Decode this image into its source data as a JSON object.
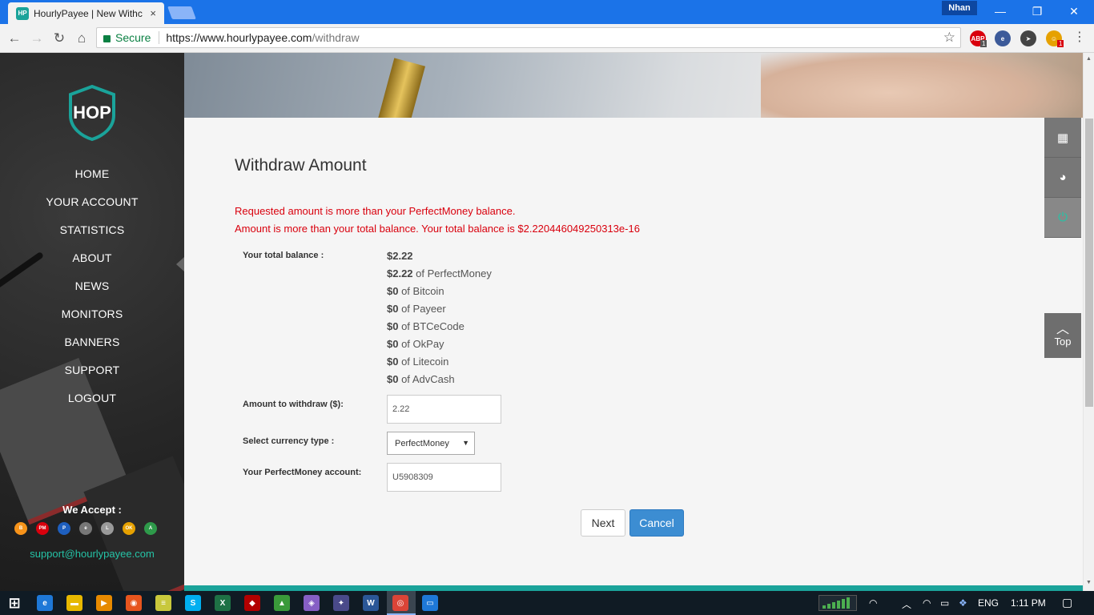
{
  "browser": {
    "tab_title": "HourlyPayee | New Withc",
    "tab_favicon_text": "HP",
    "close_glyph": "×",
    "profile_name": "Nhan",
    "window_controls": {
      "minimize": "—",
      "restore": "❐",
      "close": "✕"
    },
    "nav": {
      "back": "←",
      "forward": "→",
      "reload": "↻",
      "home": "⌂"
    },
    "secure_label": "Secure",
    "url_host": "https://www.hourlypayee.com",
    "url_path": "/withdraw",
    "star_glyph": "☆",
    "kebab_glyph": "⋮",
    "extensions": [
      {
        "name": "adblock-icon",
        "text": "ABP",
        "color": "#d9000d"
      },
      {
        "name": "extension-e-icon",
        "text": "e",
        "color": "#3c5a99"
      },
      {
        "name": "extension-arrow-icon",
        "text": "➤",
        "color": "#444444"
      },
      {
        "name": "extension-person-icon",
        "text": "☺",
        "color": "#e6a100"
      }
    ],
    "extension_badge_1": "1",
    "extension_badge_2": "1"
  },
  "sidebar": {
    "logo_text": "HOP",
    "menu": [
      "HOME",
      "YOUR ACCOUNT",
      "STATISTICS",
      "ABOUT",
      "NEWS",
      "MONITORS",
      "BANNERS",
      "SUPPORT",
      "LOGOUT"
    ],
    "we_accept": "We Accept :",
    "payment_icons": [
      {
        "name": "bitcoin-icon",
        "text": "B",
        "color": "#f7931a"
      },
      {
        "name": "perfectmoney-icon",
        "text": "PM",
        "color": "#d9000d"
      },
      {
        "name": "payeer-icon",
        "text": "P",
        "color": "#1e5fbf"
      },
      {
        "name": "btcecode-icon",
        "text": "e",
        "color": "#777777"
      },
      {
        "name": "litecoin-icon",
        "text": "L",
        "color": "#9a9a9a"
      },
      {
        "name": "okpay-icon",
        "text": "OK",
        "color": "#e6a100"
      },
      {
        "name": "advcash-icon",
        "text": "A",
        "color": "#2e9a4a"
      }
    ],
    "support_email": "support@hourlypayee.com"
  },
  "main": {
    "title": "Withdraw Amount",
    "errors": [
      "Requested amount is more than your PerfectMoney balance.",
      "Amount is more than your total balance. Your total balance is $2.220446049250313e-16"
    ],
    "total_balance_label": "Your total balance :",
    "total_balance": "$2.22",
    "balances": [
      {
        "amount": "$2.22",
        "suffix": " of PerfectMoney"
      },
      {
        "amount": "$0",
        "suffix": " of Bitcoin"
      },
      {
        "amount": "$0",
        "suffix": " of Payeer"
      },
      {
        "amount": "$0",
        "suffix": " of BTCeCode"
      },
      {
        "amount": "$0",
        "suffix": " of OkPay"
      },
      {
        "amount": "$0",
        "suffix": " of Litecoin"
      },
      {
        "amount": "$0",
        "suffix": " of AdvCash"
      }
    ],
    "amount_label": "Amount to withdraw ($):",
    "amount_value": "2.22",
    "currency_label": "Select currency type :",
    "currency_value": "PerfectMoney",
    "select_arrow": "▼",
    "account_label": "Your PerfectMoney account:",
    "account_value": "U5908309",
    "next_label": "Next",
    "cancel_label": "Cancel"
  },
  "side_tools": {
    "calculator_glyph": "▦",
    "chart_glyph": "◕",
    "power_glyph": "⏻",
    "top_chevron": "︿",
    "top_label": "Top"
  },
  "scrollbar": {
    "up": "▲",
    "down": "▼"
  },
  "taskbar": {
    "start_glyph": "⊞",
    "apps": [
      {
        "name": "edge-icon",
        "text": "e",
        "color": "#1e78d7"
      },
      {
        "name": "file-explorer-icon",
        "text": "▬",
        "color": "#e6b800"
      },
      {
        "name": "media-player-icon",
        "text": "▶",
        "color": "#e68a00"
      },
      {
        "name": "firefox-icon",
        "text": "◉",
        "color": "#e6551e"
      },
      {
        "name": "notepad-icon",
        "text": "≡",
        "color": "#c8c83c"
      },
      {
        "name": "skype-icon",
        "text": "S",
        "color": "#00aff0"
      },
      {
        "name": "excel-icon",
        "text": "X",
        "color": "#1e7145"
      },
      {
        "name": "app-red-diamond-icon",
        "text": "◆",
        "color": "#b30000"
      },
      {
        "name": "app-chart-icon",
        "text": "▲",
        "color": "#3a9a3a"
      },
      {
        "name": "visual-studio-icon",
        "text": "◈",
        "color": "#865fc5"
      },
      {
        "name": "app-compass-icon",
        "text": "✦",
        "color": "#4a4a8a"
      },
      {
        "name": "word-icon",
        "text": "W",
        "color": "#2b5797"
      },
      {
        "name": "chrome-icon",
        "text": "◎",
        "color": "#db4437"
      },
      {
        "name": "app-window-icon",
        "text": "▭",
        "color": "#1e78d7"
      }
    ],
    "chevron_up": "︿",
    "wifi_glyph": "◠",
    "battery_glyph": "▭",
    "dropbox_glyph": "❖",
    "language": "ENG",
    "time": "1:11 PM",
    "notification_glyph": "▢"
  }
}
